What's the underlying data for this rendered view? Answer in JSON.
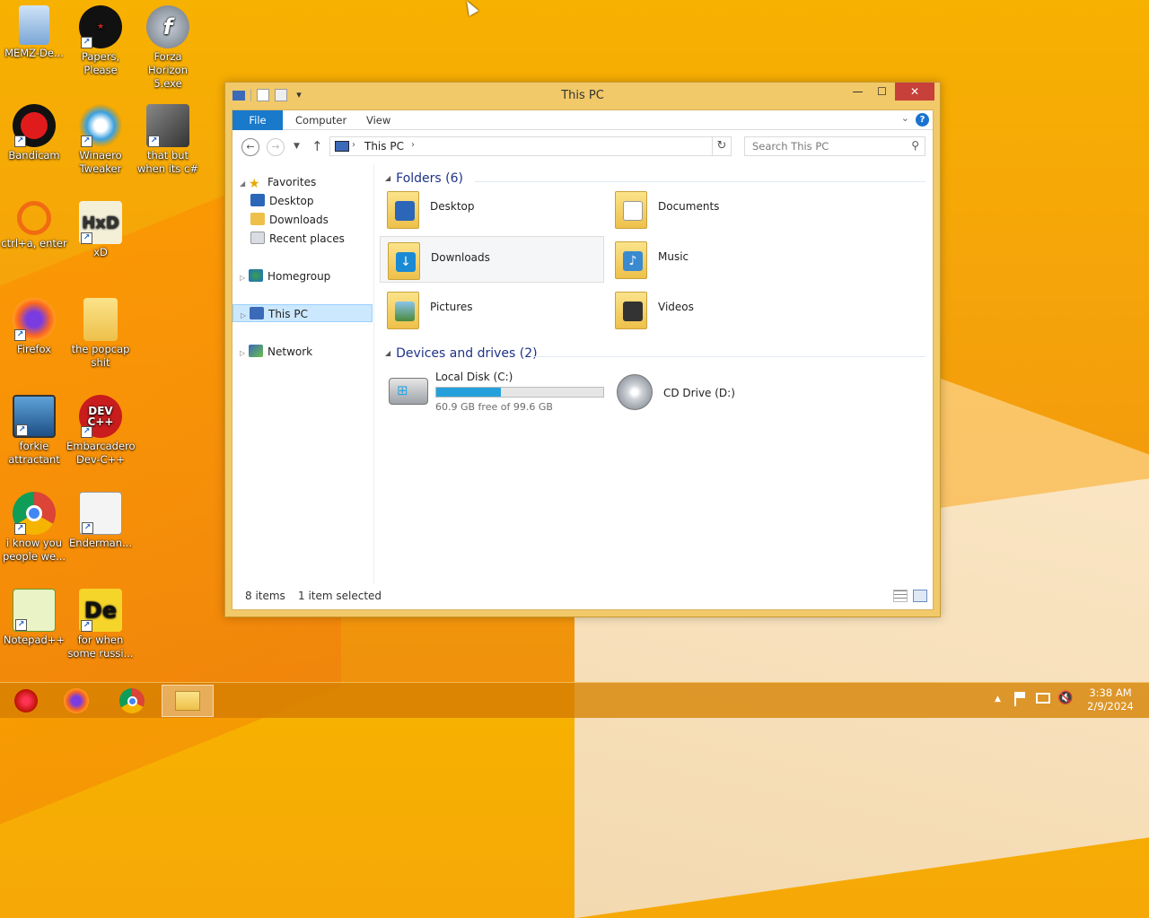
{
  "desktop": {
    "icons": [
      {
        "label": "MEMZ-De...",
        "icon": "recycle-bin-icon"
      },
      {
        "label": "Papers, Please",
        "icon": "papers-please-icon"
      },
      {
        "label": "Forza Horizon 5.exe",
        "icon": "flash-icon"
      },
      {
        "label": "Bandicam",
        "icon": "record-icon"
      },
      {
        "label": "Winaero Tweaker",
        "icon": "winaero-icon"
      },
      {
        "label": "that but when its c#",
        "icon": "stack-icon"
      },
      {
        "label": "ctrl+a, enter",
        "icon": "magnifier-icon"
      },
      {
        "label": "xD",
        "icon": "hxd-icon"
      },
      {
        "label": "Firefox",
        "icon": "firefox-icon"
      },
      {
        "label": "the popcap shit",
        "icon": "folder-doc-icon"
      },
      {
        "label": "forkie attractant",
        "icon": "monitor-gear-icon"
      },
      {
        "label": "Embarcadero Dev-C++",
        "icon": "devcpp-icon"
      },
      {
        "label": "i know you people we...",
        "icon": "chrome-icon"
      },
      {
        "label": "Enderman...",
        "icon": "window-icon"
      },
      {
        "label": "Notepad++",
        "icon": "notepadpp-icon"
      },
      {
        "label": "for when some russi...",
        "icon": "de-icon"
      }
    ]
  },
  "explorer": {
    "title": "This PC",
    "close_label": "✕",
    "min_label": "—",
    "max_label": "☐",
    "ribbon": {
      "tabs": [
        "File",
        "Computer",
        "View"
      ],
      "help": "?"
    },
    "address": {
      "path": "This PC"
    },
    "search": {
      "placeholder": "Search This PC"
    },
    "nav": {
      "favorites": "Favorites",
      "fav_items": [
        "Desktop",
        "Downloads",
        "Recent places"
      ],
      "homegroup": "Homegroup",
      "thispc": "This PC",
      "network": "Network"
    },
    "folders": {
      "header": "Folders (6)",
      "items": [
        "Desktop",
        "Documents",
        "Downloads",
        "Music",
        "Pictures",
        "Videos"
      ]
    },
    "drives": {
      "header": "Devices and drives (2)",
      "items": [
        {
          "name": "Local Disk (C:)",
          "free": "60.9 GB free of 99.6 GB",
          "used_fraction": 0.389
        },
        {
          "name": "CD Drive (D:)"
        }
      ]
    },
    "status": {
      "items": "8 items",
      "selected": "1 item selected"
    }
  },
  "taskbar": {
    "clock": {
      "time": "3:38 AM",
      "date": "2/9/2024"
    },
    "tray_arrow": "▲"
  },
  "colors": {
    "accent": "#1979ca",
    "window_frame": "#f1c969",
    "close": "#c7403a",
    "progress": "#26a0da"
  }
}
